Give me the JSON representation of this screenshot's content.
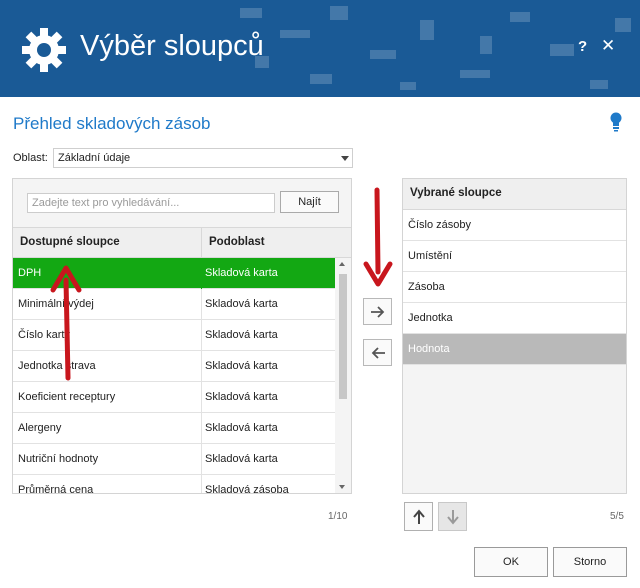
{
  "window": {
    "title": "Výběr sloupců",
    "help_label": "?",
    "close_label": "✕"
  },
  "subtitle": "Přehled skladových zásob",
  "area": {
    "label": "Oblast:",
    "selected_value": "Základní údaje"
  },
  "search": {
    "placeholder": "Zadejte text pro vyhledávání...",
    "value": "",
    "button_label": "Najít"
  },
  "available": {
    "columns": [
      "Dostupné sloupce",
      "Podoblast"
    ],
    "rows": [
      [
        "DPH",
        "Skladová karta"
      ],
      [
        "Minimální výdej",
        "Skladová karta"
      ],
      [
        "Číslo karty",
        "Skladová karta"
      ],
      [
        "Jednotka strava",
        "Skladová karta"
      ],
      [
        "Koeficient receptury",
        "Skladová karta"
      ],
      [
        "Alergeny",
        "Skladová karta"
      ],
      [
        "Nutriční hodnoty",
        "Skladová karta"
      ],
      [
        "Průměrná cena",
        "Skladová zásoba"
      ]
    ],
    "selected_index": 0,
    "counter": "1/10"
  },
  "selected": {
    "header": "Vybrané sloupce",
    "rows": [
      "Číslo zásoby",
      "Umístění",
      "Zásoba",
      "Jednotka",
      "Hodnota"
    ],
    "selected_index": 4,
    "counter": "5/5"
  },
  "buttons": {
    "ok": "OK",
    "cancel": "Storno"
  },
  "colors": {
    "header_bg": "#1a5a96",
    "accent": "#1f7ac9",
    "selected_row": "#13a813",
    "selected_right_row": "#b9b9b9",
    "annotation_arrow": "#c8161d"
  },
  "icons": {
    "app": "gear-icon",
    "hint": "lightbulb-icon",
    "add": "arrow-right-icon",
    "remove": "arrow-left-icon",
    "move_up": "arrow-up-icon",
    "move_down": "arrow-down-icon"
  }
}
